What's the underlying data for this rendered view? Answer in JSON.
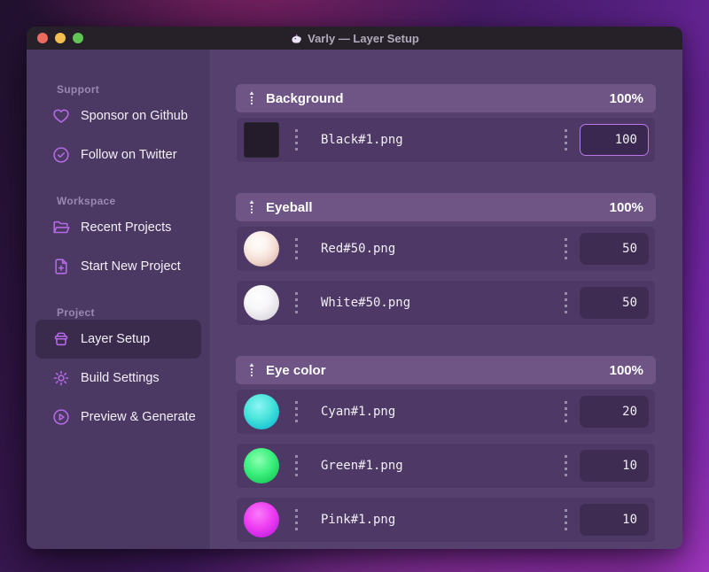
{
  "window": {
    "title": "Varly — Layer Setup",
    "app_icon": "unicorn-icon"
  },
  "titlebar_buttons": [
    {
      "name": "close",
      "color": "#ec6a5e"
    },
    {
      "name": "minimize",
      "color": "#f5bf4f"
    },
    {
      "name": "zoom",
      "color": "#61c554"
    }
  ],
  "sidebar": {
    "sections": [
      {
        "label": "Support",
        "items": [
          {
            "label": "Sponsor on Github",
            "icon": "heart-icon",
            "selected": false
          },
          {
            "label": "Follow on Twitter",
            "icon": "verified-badge-icon",
            "selected": false
          }
        ]
      },
      {
        "label": "Workspace",
        "items": [
          {
            "label": "Recent Projects",
            "icon": "folder-open-icon",
            "selected": false
          },
          {
            "label": "Start New Project",
            "icon": "file-plus-icon",
            "selected": false
          }
        ]
      },
      {
        "label": "Project",
        "items": [
          {
            "label": "Layer Setup",
            "icon": "layers-box-icon",
            "selected": true
          },
          {
            "label": "Build Settings",
            "icon": "gear-icon",
            "selected": false
          },
          {
            "label": "Preview & Generate",
            "icon": "play-circle-icon",
            "selected": false
          }
        ]
      }
    ]
  },
  "layers": {
    "groups": [
      {
        "name": "Background",
        "weight": "100%",
        "rows": [
          {
            "file": "Black#1.png",
            "value": "100",
            "thumb": "black-square",
            "focused": true
          }
        ]
      },
      {
        "name": "Eyeball",
        "weight": "100%",
        "rows": [
          {
            "file": "Red#50.png",
            "value": "50",
            "thumb": "red-sphere",
            "focused": false
          },
          {
            "file": "White#50.png",
            "value": "50",
            "thumb": "white-sphere",
            "focused": false
          }
        ]
      },
      {
        "name": "Eye color",
        "weight": "100%",
        "rows": [
          {
            "file": "Cyan#1.png",
            "value": "20",
            "thumb": "cyan-sphere",
            "focused": false
          },
          {
            "file": "Green#1.png",
            "value": "10",
            "thumb": "green-sphere",
            "focused": false
          },
          {
            "file": "Pink#1.png",
            "value": "10",
            "thumb": "pink-sphere",
            "focused": false
          }
        ]
      }
    ]
  },
  "colors": {
    "accent": "#b46ae6",
    "focus_border": "#b978ea",
    "window_main_bg": "#56416e",
    "window_sidebar_bg": "#4c3963",
    "group_header_bg": "#6e5586",
    "row_bg": "#4d3866",
    "titlebar_bg": "#262129"
  }
}
